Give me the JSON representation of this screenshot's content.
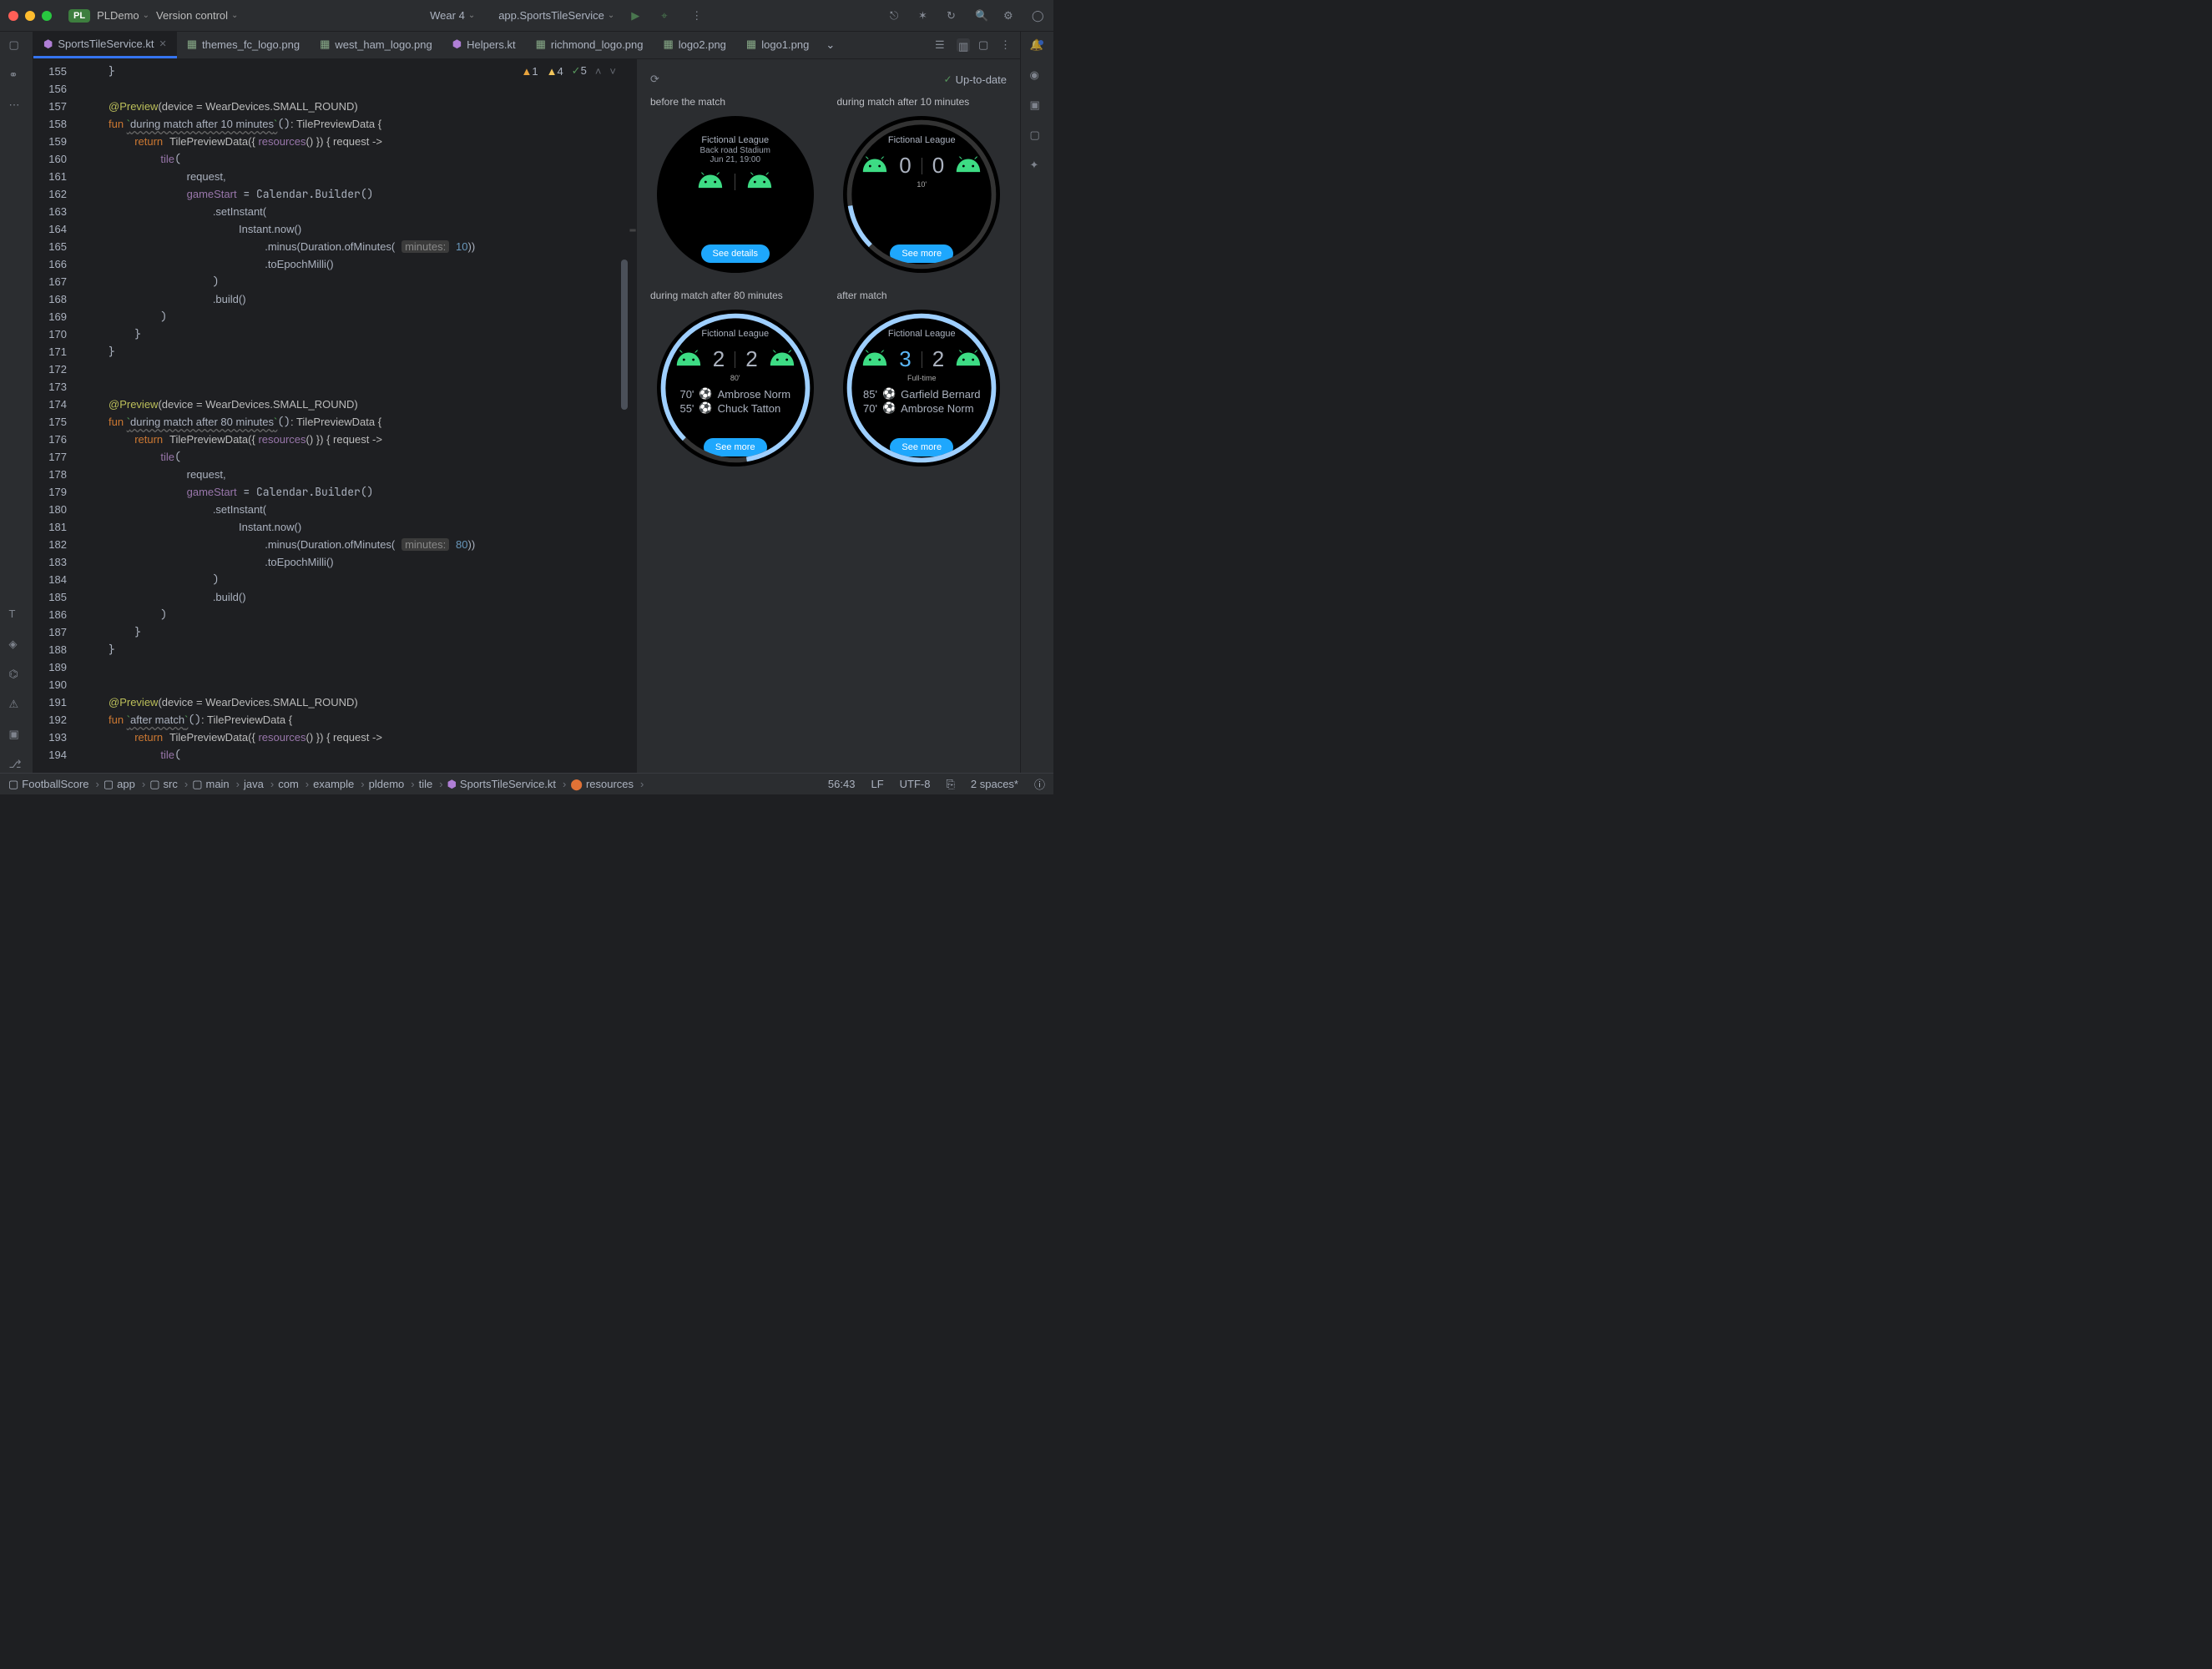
{
  "project": {
    "badge": "PL",
    "name": "PLDemo",
    "vcs": "Version control"
  },
  "run": {
    "device": "Wear 4",
    "config": "app.SportsTileService"
  },
  "tabs": [
    {
      "label": "SportsTileService.kt",
      "active": true,
      "kind": "kt"
    },
    {
      "label": "themes_fc_logo.png",
      "kind": "img"
    },
    {
      "label": "west_ham_logo.png",
      "kind": "img"
    },
    {
      "label": "Helpers.kt",
      "kind": "kt"
    },
    {
      "label": "richmond_logo.png",
      "kind": "img"
    },
    {
      "label": "logo2.png",
      "kind": "img"
    },
    {
      "label": "logo1.png",
      "kind": "img"
    }
  ],
  "inspection": {
    "warningsA": "1",
    "warningsB": "4",
    "hints": "5"
  },
  "preview": {
    "status": "Up-to-date"
  },
  "watches": [
    {
      "label": "before the match",
      "title": "Fictional League",
      "line2": "Back road Stadium",
      "line3": "Jun 21, 19:00",
      "button": "See details",
      "scoreL": "",
      "scoreR": "",
      "time": "",
      "events": [],
      "progress": 0
    },
    {
      "label": "during match after 10 minutes",
      "title": "Fictional League",
      "scoreL": "0",
      "scoreR": "0",
      "time": "10'",
      "button": "See more",
      "events": [],
      "progress": 10
    },
    {
      "label": "during match after 80 minutes",
      "title": "Fictional League",
      "scoreL": "2",
      "scoreR": "2",
      "time": "80'",
      "button": "See more",
      "events": [
        {
          "t": "70'",
          "p": "Ambrose Norm"
        },
        {
          "t": "55'",
          "p": "Chuck Tatton"
        }
      ],
      "progress": 85
    },
    {
      "label": "after match",
      "title": "Fictional League",
      "scoreL": "3",
      "scoreLBlue": true,
      "scoreR": "2",
      "time": "Full-time",
      "button": "See more",
      "events": [
        {
          "t": "85'",
          "p": "Garfield Bernard"
        },
        {
          "t": "70'",
          "p": "Ambrose Norm"
        }
      ],
      "progress": 100
    }
  ],
  "breadcrumbs": [
    "FootballScore",
    "app",
    "src",
    "main",
    "java",
    "com",
    "example",
    "pldemo",
    "tile",
    "SportsTileService.kt",
    "resources"
  ],
  "status": {
    "pos": "56:43",
    "sep": "LF",
    "enc": "UTF-8",
    "indent": "2 spaces*"
  },
  "code": {
    "lines": [
      155,
      156,
      157,
      158,
      159,
      160,
      161,
      162,
      163,
      164,
      165,
      166,
      167,
      168,
      169,
      170,
      171,
      172,
      173,
      174,
      175,
      176,
      177,
      178,
      179,
      180,
      181,
      182,
      183,
      184,
      185,
      186,
      187,
      188,
      189,
      190,
      191,
      192,
      193,
      194
    ],
    "fn1": "during match after 10 minutes",
    "fn2": "during match after 80 minutes",
    "fn3": "after match",
    "min1": "10",
    "min2": "80",
    "annot": "@Preview",
    "annotArg": "(device = WearDevices.SMALL_ROUND)",
    "retType": ": TilePreviewData {",
    "ret": "return",
    "tpd": "TilePreviewData({ ",
    "res": "resources",
    "tpd2": "() }) { request ->",
    "tile": "tile",
    "req": "request,",
    "gs": "gameStart",
    " = Calendar.Builder()": "",
    "si": ".setInstant(",
    "inst": "Instant.now()",
    "minus": ".minus(Duration.ofMinutes(",
    "paramLabel": "minutes:",
    "close": "))",
    "tem": ".toEpochMilli()",
    "build": ".build()"
  }
}
